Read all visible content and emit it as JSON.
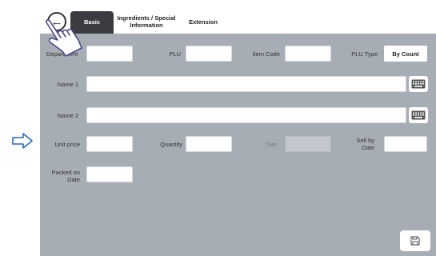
{
  "tabs": [
    {
      "label": "Basic",
      "active": true
    },
    {
      "label": "Ingredients / Special Information",
      "active": false
    },
    {
      "label": "Extension",
      "active": false
    }
  ],
  "fields": {
    "department": {
      "label": "Department",
      "value": ""
    },
    "plu": {
      "label": "PLU",
      "value": ""
    },
    "item_code": {
      "label": "Item Code",
      "value": ""
    },
    "plu_type": {
      "label": "PLU Type",
      "value": "By Count"
    },
    "name1": {
      "label": "Name 1",
      "value": ""
    },
    "name2": {
      "label": "Name 2",
      "value": ""
    },
    "unit_price": {
      "label": "Unit price",
      "value": ""
    },
    "quantity": {
      "label": "Quantity",
      "value": ""
    },
    "tare": {
      "label": "Tare",
      "value": ""
    },
    "sell_by_date": {
      "label": "Sell by Date",
      "value": ""
    },
    "packed_on_date": {
      "label": "Packed on Date",
      "value": ""
    }
  },
  "icons": {
    "back": "back-arrow-icon",
    "keyboard": "keyboard-icon",
    "save": "save-icon",
    "pointer_arrow": "right-arrow-icon",
    "hand": "hand-pointer-icon"
  },
  "colors": {
    "panel": "#a7adb5",
    "active_tab": "#3a3c40",
    "field": "#ffffff",
    "disabled_field": "#c3c8ce"
  }
}
